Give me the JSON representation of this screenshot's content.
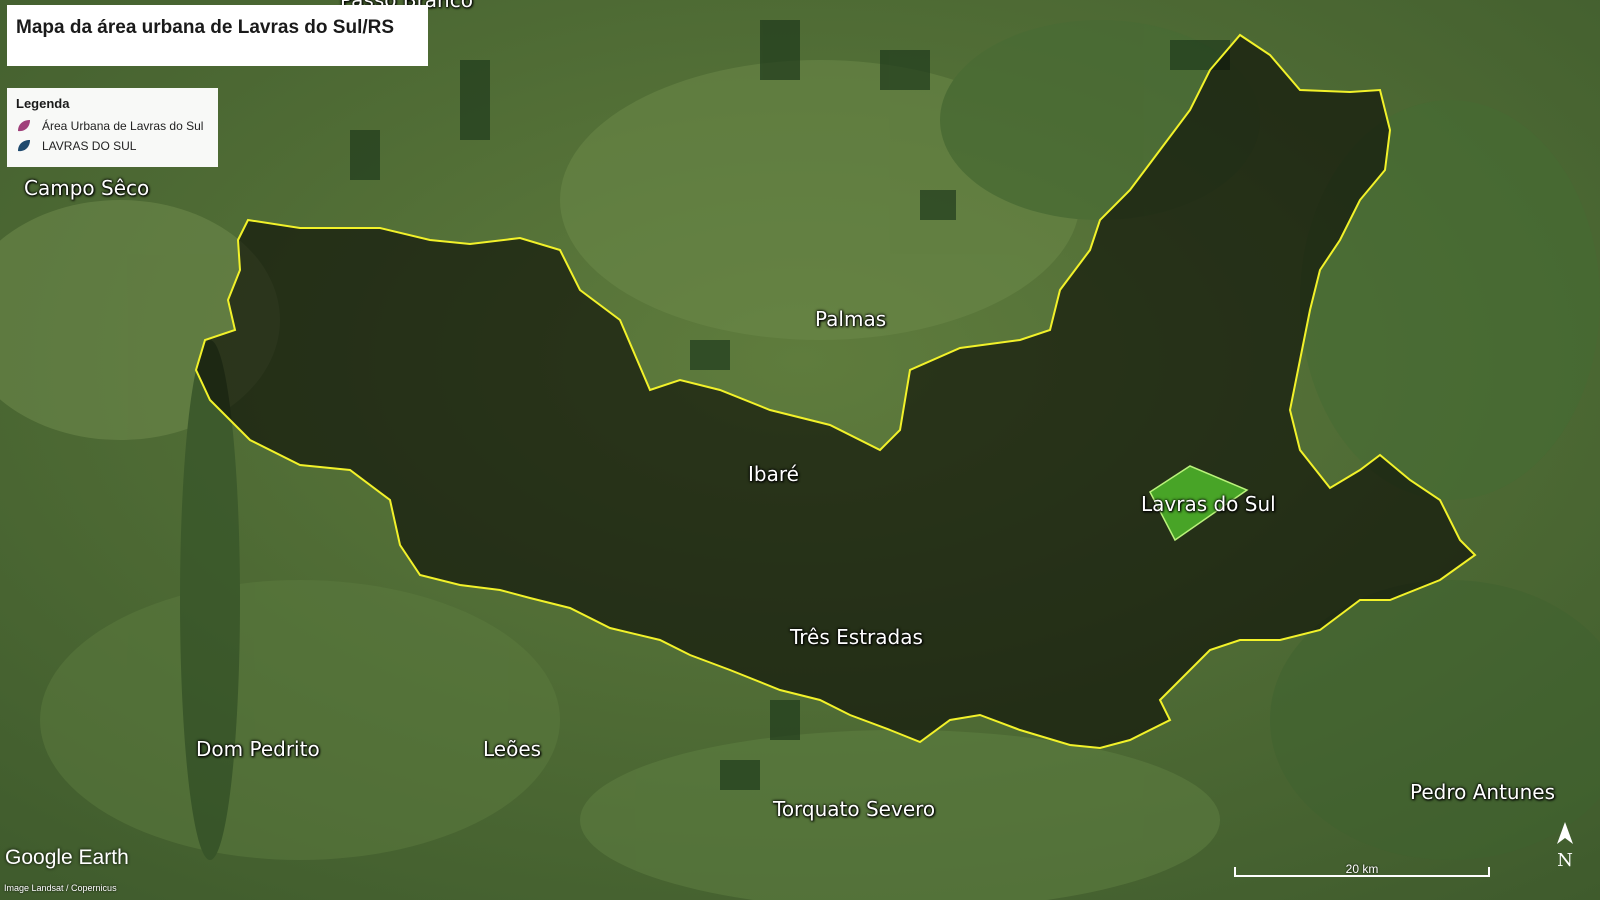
{
  "title": "Mapa da área urbana de Lavras do Sul/RS",
  "legend": {
    "title": "Legenda",
    "items": [
      {
        "label": "Área Urbana de Lavras do Sul",
        "color": "#a0407a"
      },
      {
        "label": "LAVRAS DO SUL",
        "color": "#1f4a6e"
      }
    ]
  },
  "places": {
    "top_partial": "Passo Branco",
    "campo_seco": "Campo Sêco",
    "palmas": "Palmas",
    "ibare": "Ibaré",
    "lavras": "Lavras do Sul",
    "tres_estradas": "Três Estradas",
    "dom_pedrito": "Dom Pedrito",
    "leoes": "Leões",
    "torquato": "Torquato Severo",
    "pedro_antunes": "Pedro Antunes"
  },
  "branding": {
    "logo": "Google Earth",
    "credit": "Image Landsat / Copernicus"
  },
  "scale_bar": {
    "label": "20 km"
  },
  "north_arrow": {
    "label": "N"
  },
  "colors": {
    "boundary": "#f2f22a",
    "urban_fill": "#4fb82a",
    "municipality_shade": "#0a0a05"
  }
}
